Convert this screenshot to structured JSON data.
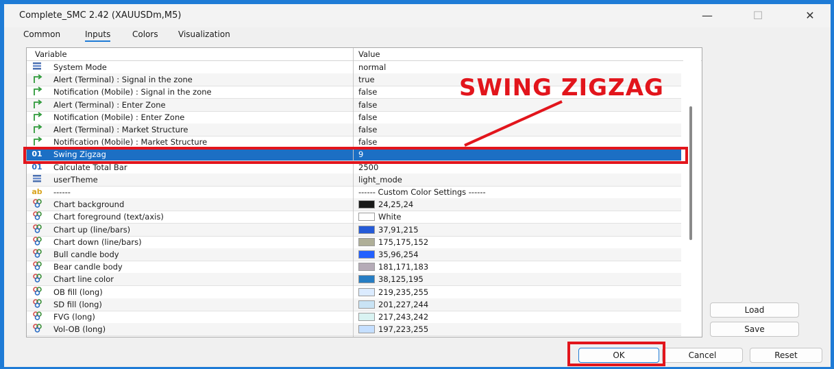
{
  "window": {
    "title": "Complete_SMC 2.42 (XAUUSDm,M5)",
    "minimize": "—",
    "maximize": "☐",
    "close": "✕"
  },
  "tabs": [
    {
      "label": "Common"
    },
    {
      "label": "Inputs"
    },
    {
      "label": "Colors"
    },
    {
      "label": "Visualization"
    }
  ],
  "active_tab": "Inputs",
  "grid": {
    "header_variable": "Variable",
    "header_value": "Value",
    "rows": [
      {
        "icon": "enum",
        "variable": "System Mode",
        "value": "normal"
      },
      {
        "icon": "bool",
        "variable": "Alert (Terminal) : Signal in the zone",
        "value": "true"
      },
      {
        "icon": "bool",
        "variable": "Notification (Mobile) : Signal in the zone",
        "value": "false"
      },
      {
        "icon": "bool",
        "variable": "Alert (Terminal) : Enter Zone",
        "value": "false"
      },
      {
        "icon": "bool",
        "variable": "Notification (Mobile) : Enter Zone",
        "value": "false"
      },
      {
        "icon": "bool",
        "variable": "Alert (Terminal) : Market Structure",
        "value": "false"
      },
      {
        "icon": "bool",
        "variable": "Notification (Mobile) : Market Structure",
        "value": "false"
      },
      {
        "icon": "int",
        "variable": "Swing Zigzag",
        "value": "9",
        "selected": true
      },
      {
        "icon": "int",
        "variable": "Calculate Total Bar",
        "value": "2500"
      },
      {
        "icon": "enum",
        "variable": "userTheme",
        "value": "light_mode"
      },
      {
        "icon": "string",
        "variable": "------",
        "value": "------ Custom Color Settings ------"
      },
      {
        "icon": "color",
        "variable": "Chart background",
        "value": "24,25,24",
        "swatch": "#181918"
      },
      {
        "icon": "color",
        "variable": "Chart foreground (text/axis)",
        "value": "White",
        "swatch": "#ffffff"
      },
      {
        "icon": "color",
        "variable": "Chart up (line/bars)",
        "value": "37,91,215",
        "swatch": "#255bd7"
      },
      {
        "icon": "color",
        "variable": "Chart down (line/bars)",
        "value": "175,175,152",
        "swatch": "#afaf98"
      },
      {
        "icon": "color",
        "variable": "Bull candle body",
        "value": "35,96,254",
        "swatch": "#2360fe"
      },
      {
        "icon": "color",
        "variable": "Bear candle body",
        "value": "181,171,183",
        "swatch": "#b5abb7"
      },
      {
        "icon": "color",
        "variable": "Chart line color",
        "value": "38,125,195",
        "swatch": "#267dc3"
      },
      {
        "icon": "color",
        "variable": "OB fill (long)",
        "value": "219,235,255",
        "swatch": "#dbebff"
      },
      {
        "icon": "color",
        "variable": "SD fill (long)",
        "value": "201,227,244",
        "swatch": "#c9e3f4"
      },
      {
        "icon": "color",
        "variable": "FVG (long)",
        "value": "217,243,242",
        "swatch": "#d9f3f2"
      },
      {
        "icon": "color",
        "variable": "Vol-OB (long)",
        "value": "197,223,255",
        "swatch": "#c5dfff"
      }
    ]
  },
  "buttons": {
    "load": "Load",
    "save": "Save",
    "ok": "OK",
    "cancel": "Cancel",
    "reset": "Reset"
  },
  "annotation": {
    "text": "SWING ZIGZAG"
  },
  "colors": {
    "accent": "#1e7bd6",
    "selection": "#1c6fc4",
    "annotation_red": "#e2151c"
  }
}
